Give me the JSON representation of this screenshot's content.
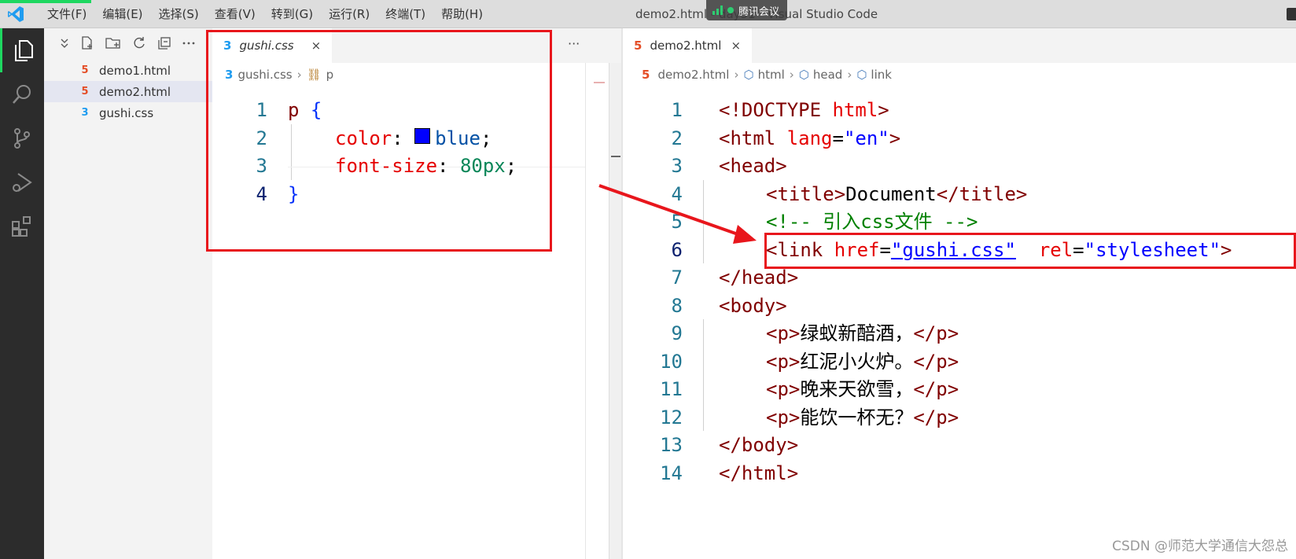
{
  "titlebar": {
    "menu": [
      "文件(F)",
      "编辑(E)",
      "选择(S)",
      "查看(V)",
      "转到(G)",
      "运行(R)",
      "终端(T)",
      "帮助(H)"
    ],
    "title": "demo2.html - day31 - Visual Studio Code",
    "meeting": "腾讯会议"
  },
  "activity_bar": [
    "explorer-icon",
    "search-icon",
    "source-control-icon",
    "run-debug-icon",
    "extensions-icon"
  ],
  "sidebar": {
    "files": [
      {
        "name": "demo1.html",
        "type": "html"
      },
      {
        "name": "demo2.html",
        "type": "html"
      },
      {
        "name": "gushi.css",
        "type": "css"
      }
    ]
  },
  "left_editor": {
    "tab": "gushi.css",
    "close": "×",
    "more": "···",
    "breadcrumb": [
      "gushi.css",
      "p"
    ],
    "line_numbers": [
      "1",
      "2",
      "3",
      "4"
    ],
    "lines": {
      "l1": {
        "sel": "p",
        "brace": " {"
      },
      "l2": {
        "prop": "color",
        "colon": ": ",
        "val": "blue",
        "end": ";"
      },
      "l3": {
        "prop": "font-size",
        "colon": ": ",
        "val": "80px",
        "end": ";"
      },
      "l4": {
        "brace": "}"
      }
    }
  },
  "right_editor": {
    "tab": "demo2.html",
    "close": "×",
    "breadcrumb": [
      "demo2.html",
      "html",
      "head",
      "link"
    ],
    "line_numbers": [
      "1",
      "2",
      "3",
      "4",
      "5",
      "6",
      "7",
      "8",
      "9",
      "10",
      "11",
      "12",
      "13",
      "14"
    ],
    "lines": {
      "l1": {
        "a": "<!DOCTYPE ",
        "b": "html",
        "c": ">"
      },
      "l2": {
        "a": "<html ",
        "attr": "lang",
        "eq": "=",
        "str": "\"en\"",
        "c": ">"
      },
      "l3": {
        "a": "<head>"
      },
      "l4": {
        "a": "<title>",
        "txt": "Document",
        "c": "</title>"
      },
      "l5": {
        "cmt": "<!-- 引入css文件 -->"
      },
      "l6": {
        "a": "<link ",
        "attr1": "href",
        "eq1": "=",
        "str1": "\"gushi.css\"",
        "sp": "  ",
        "attr2": "rel",
        "eq2": "=",
        "str2": "\"stylesheet\"",
        "c": ">"
      },
      "l7": {
        "a": "</head>"
      },
      "l8": {
        "a": "<body>"
      },
      "l9": {
        "a": "<p>",
        "txt": "绿蚁新醅酒，",
        "c": "</p>"
      },
      "l10": {
        "a": "<p>",
        "txt": "红泥小火炉。",
        "c": "</p>"
      },
      "l11": {
        "a": "<p>",
        "txt": "晚来天欲雪，",
        "c": "</p>"
      },
      "l12": {
        "a": "<p>",
        "txt": "能饮一杯无？",
        "c": "</p>"
      },
      "l13": {
        "a": "</body>"
      },
      "l14": {
        "a": "</html>"
      }
    }
  },
  "colors": {
    "annotation_red": "#e8161c",
    "blue_swatch": "#0000ff"
  },
  "watermark": "CSDN @师范大学通信大怨总"
}
